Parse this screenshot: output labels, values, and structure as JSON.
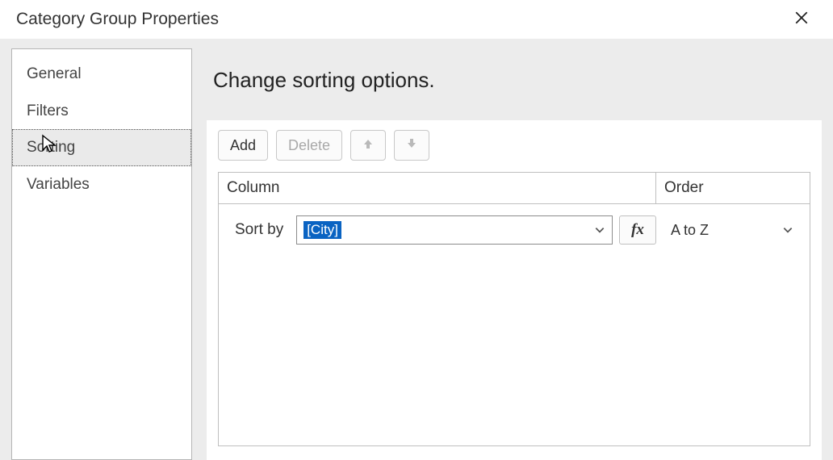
{
  "window": {
    "title": "Category Group Properties"
  },
  "sidebar": {
    "items": [
      {
        "label": "General"
      },
      {
        "label": "Filters"
      },
      {
        "label": "Sorting",
        "selected": true
      },
      {
        "label": "Variables"
      }
    ]
  },
  "main": {
    "heading": "Change sorting options.",
    "toolbar": {
      "add": "Add",
      "delete": "Delete"
    },
    "grid": {
      "headers": {
        "column": "Column",
        "order": "Order"
      },
      "row": {
        "label": "Sort by",
        "expression": "[City]",
        "fx": "fx",
        "order_value": "A to Z"
      }
    }
  }
}
